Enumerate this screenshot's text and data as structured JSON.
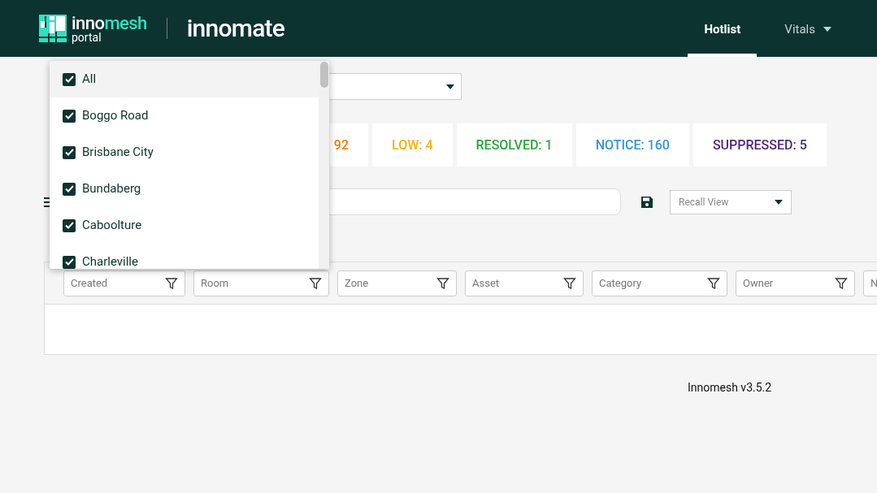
{
  "header": {
    "brand": {
      "first": "inno",
      "second": "mesh",
      "sub": "portal"
    },
    "product": "innomate",
    "nav": [
      {
        "label": "Hotlist",
        "selected": true,
        "dropdown": false
      },
      {
        "label": "Vitals",
        "selected": false,
        "dropdown": true
      }
    ]
  },
  "site_dropdown": {
    "expanded": true,
    "options": [
      {
        "label": "All",
        "checked": true,
        "highlighted": true
      },
      {
        "label": "Boggo Road",
        "checked": true,
        "highlighted": false
      },
      {
        "label": "Brisbane City",
        "checked": true,
        "highlighted": false
      },
      {
        "label": "Bundaberg",
        "checked": true,
        "highlighted": false
      },
      {
        "label": "Caboolture",
        "checked": true,
        "highlighted": false
      },
      {
        "label": "Charleville",
        "checked": true,
        "highlighted": false
      }
    ]
  },
  "stats": [
    {
      "label": "92",
      "color": "#f57c00"
    },
    {
      "label": "LOW: 4",
      "color": "#f9b208"
    },
    {
      "label": "RESOLVED: 1",
      "color": "#2ea63a"
    },
    {
      "label": "NOTICE: 160",
      "color": "#3a96d6"
    },
    {
      "label": "SUPPRESSED: 5",
      "color": "#4e2a7a"
    }
  ],
  "toolbar": {
    "recall_placeholder": "Recall View"
  },
  "table": {
    "filters": [
      "Created",
      "Room",
      "Zone",
      "Asset",
      "Category",
      "Owner",
      "N"
    ]
  },
  "footer": "Innomesh v3.5.2"
}
